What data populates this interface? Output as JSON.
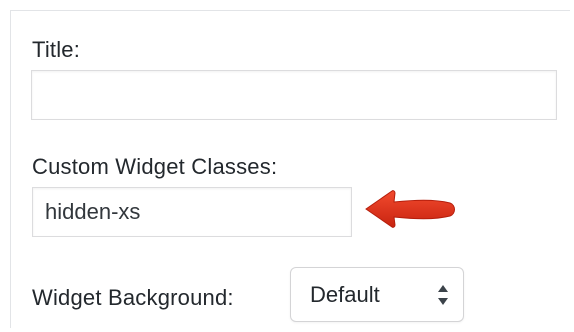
{
  "widget_form": {
    "title": {
      "label": "Title:",
      "value": ""
    },
    "custom_classes": {
      "label": "Custom Widget Classes:",
      "value": "hidden-xs"
    },
    "background": {
      "label": "Widget Background:",
      "selected": "Default"
    }
  },
  "icons": {
    "annotation": "red-arrow-left-icon",
    "select_toggle": "updown-chevron-icon"
  },
  "colors": {
    "label_text": "#23282d",
    "input_border": "#dcdcde",
    "arrow_red": "#e2321b"
  }
}
